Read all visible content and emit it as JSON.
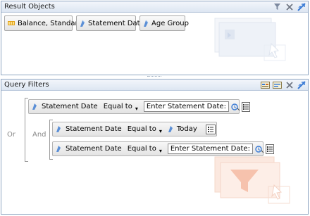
{
  "result_objects": {
    "title": "Result Objects",
    "items": [
      {
        "label": "Balance, Standard",
        "icon": "measure-icon"
      },
      {
        "label": "Statement Date",
        "icon": "dimension-icon"
      },
      {
        "label": "Age Group",
        "icon": "dimension-icon"
      }
    ]
  },
  "query_filters": {
    "title": "Query Filters",
    "or_label": "Or",
    "and_label": "And",
    "filters": [
      {
        "object": "Statement Date",
        "operator": "Equal to",
        "value": "Enter Statement Date:"
      },
      {
        "object": "Statement Date",
        "operator": "Equal to",
        "value": "Today"
      },
      {
        "object": "Statement Date",
        "operator": "Equal to",
        "value": "Enter Statement Date:"
      }
    ]
  },
  "colors": {
    "border": "#8fa6c2",
    "header_bg": "#dde6f2",
    "dimension_icon": "#5b8fd6",
    "measure_icon": "#e3a21a",
    "watermark": "#f6c9b7"
  }
}
